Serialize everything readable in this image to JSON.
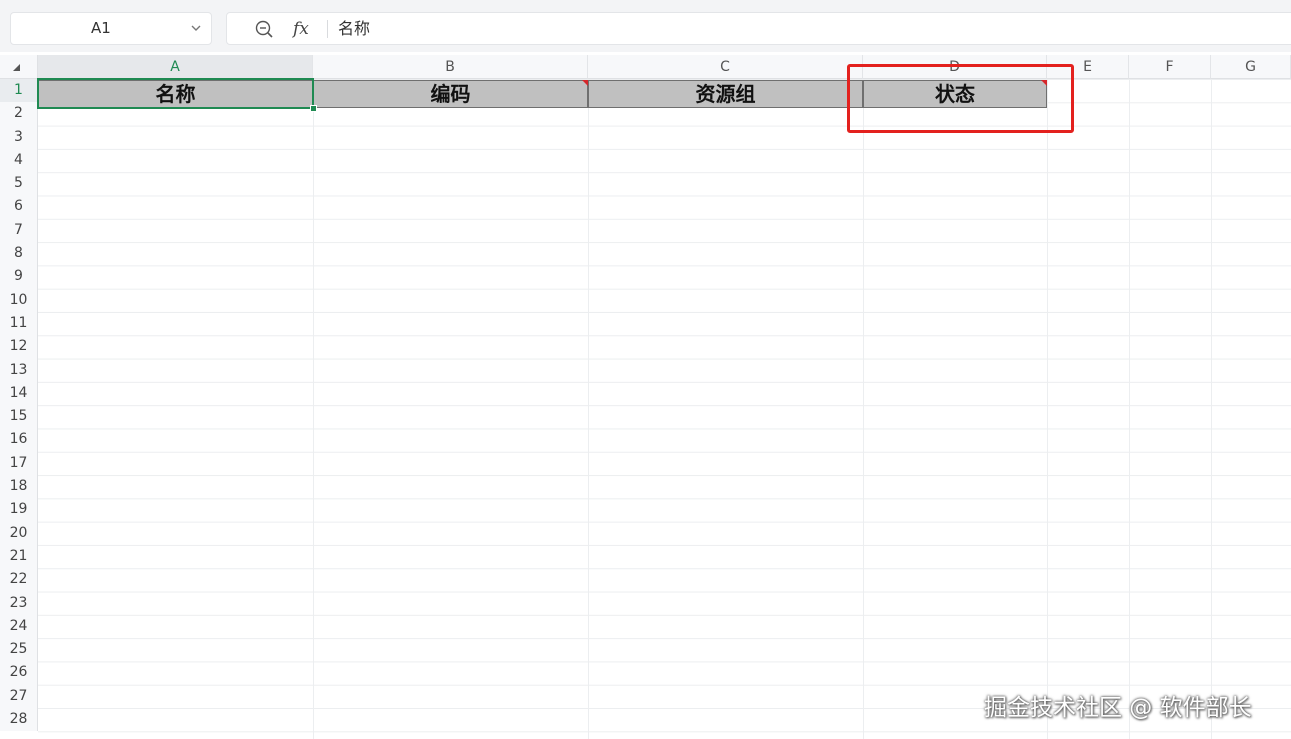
{
  "formula_bar": {
    "cell_ref": "A1",
    "fx_label": "fx",
    "formula_value": "名称"
  },
  "columns": [
    {
      "label": "A",
      "active": true
    },
    {
      "label": "B",
      "active": false
    },
    {
      "label": "C",
      "active": false
    },
    {
      "label": "D",
      "active": false
    },
    {
      "label": "E",
      "active": false
    },
    {
      "label": "F",
      "active": false
    },
    {
      "label": "G",
      "active": false
    }
  ],
  "rows": [
    "1",
    "2",
    "3",
    "4",
    "5",
    "6",
    "7",
    "8",
    "9",
    "10",
    "11",
    "12",
    "13",
    "14",
    "15",
    "16",
    "17",
    "18",
    "19",
    "20",
    "21",
    "22",
    "23",
    "24",
    "25",
    "26",
    "27",
    "28"
  ],
  "header_cells": [
    "名称",
    "编码",
    "资源组",
    "状态"
  ],
  "watermark": "掘金技术社区 @ 软件部长",
  "colors": {
    "accent": "#1f8a52",
    "header_fill": "#c0c0c0",
    "highlight": "#e3211e",
    "comment_marker": "#d6262a"
  }
}
